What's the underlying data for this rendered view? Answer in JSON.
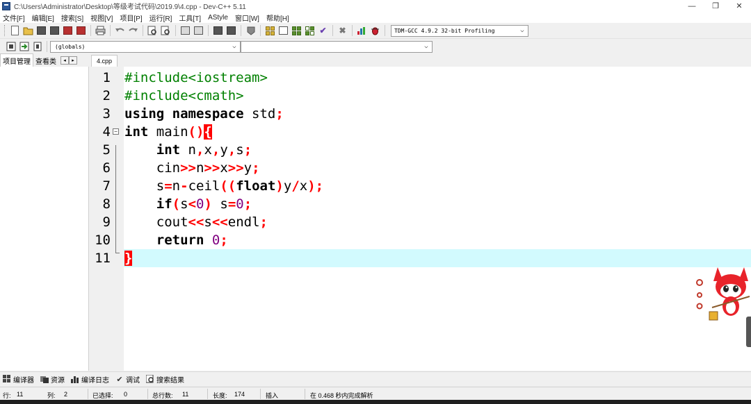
{
  "window": {
    "title": "C:\\Users\\Administrator\\Desktop\\等级考试代码\\2019.9\\4.cpp - Dev-C++ 5.11",
    "minimize": "—",
    "maximize": "❐",
    "close": "✕"
  },
  "menu": [
    "文件[F]",
    "编辑[E]",
    "搜索[S]",
    "视图[V]",
    "项目[P]",
    "运行[R]",
    "工具[T]",
    "AStyle",
    "窗口[W]",
    "帮助[H]"
  ],
  "toolbar": {
    "compiler": "TDM-GCC 4.9.2 32-bit Profiling",
    "scope": "(globals)",
    "symbol": ""
  },
  "left_panel": {
    "tabs": [
      "项目管理",
      "查看类"
    ],
    "nav_prev": "◂",
    "nav_next": "▸"
  },
  "editor": {
    "file_tab": "4.cpp",
    "line_numbers": [
      "1",
      "2",
      "3",
      "4",
      "5",
      "6",
      "7",
      "8",
      "9",
      "10",
      "11"
    ],
    "current_line": 11
  },
  "code_lines": [
    [
      {
        "t": "#include<iostream>",
        "c": "pp"
      }
    ],
    [
      {
        "t": "#include<cmath>",
        "c": "pp"
      }
    ],
    [
      {
        "t": "using namespace",
        "c": "kw"
      },
      {
        "t": " std",
        "c": ""
      },
      {
        "t": ";",
        "c": "sym"
      }
    ],
    [
      {
        "t": "int",
        "c": "kw"
      },
      {
        "t": " main",
        "c": ""
      },
      {
        "t": "()",
        "c": "sym"
      },
      {
        "t": "{",
        "c": "hl"
      }
    ],
    [
      {
        "t": "    ",
        "c": ""
      },
      {
        "t": "int",
        "c": "kw"
      },
      {
        "t": " n",
        "c": ""
      },
      {
        "t": ",",
        "c": "sym"
      },
      {
        "t": "x",
        "c": ""
      },
      {
        "t": ",",
        "c": "sym"
      },
      {
        "t": "y",
        "c": ""
      },
      {
        "t": ",",
        "c": "sym"
      },
      {
        "t": "s",
        "c": ""
      },
      {
        "t": ";",
        "c": "sym"
      }
    ],
    [
      {
        "t": "    cin",
        "c": ""
      },
      {
        "t": ">>",
        "c": "sym"
      },
      {
        "t": "n",
        "c": ""
      },
      {
        "t": ">>",
        "c": "sym"
      },
      {
        "t": "x",
        "c": ""
      },
      {
        "t": ">>",
        "c": "sym"
      },
      {
        "t": "y",
        "c": ""
      },
      {
        "t": ";",
        "c": "sym"
      }
    ],
    [
      {
        "t": "    s",
        "c": ""
      },
      {
        "t": "=",
        "c": "sym"
      },
      {
        "t": "n",
        "c": ""
      },
      {
        "t": "-",
        "c": "sym"
      },
      {
        "t": "ceil",
        "c": ""
      },
      {
        "t": "((",
        "c": "sym"
      },
      {
        "t": "float",
        "c": "kw"
      },
      {
        "t": ")",
        "c": "sym"
      },
      {
        "t": "y",
        "c": ""
      },
      {
        "t": "/",
        "c": "sym"
      },
      {
        "t": "x",
        "c": ""
      },
      {
        "t": ");",
        "c": "sym"
      }
    ],
    [
      {
        "t": "    ",
        "c": ""
      },
      {
        "t": "if",
        "c": "kw"
      },
      {
        "t": "(",
        "c": "sym"
      },
      {
        "t": "s",
        "c": ""
      },
      {
        "t": "<",
        "c": "sym"
      },
      {
        "t": "0",
        "c": "num"
      },
      {
        "t": ")",
        "c": "sym"
      },
      {
        "t": " s",
        "c": ""
      },
      {
        "t": "=",
        "c": "sym"
      },
      {
        "t": "0",
        "c": "num"
      },
      {
        "t": ";",
        "c": "sym"
      }
    ],
    [
      {
        "t": "    cout",
        "c": ""
      },
      {
        "t": "<<",
        "c": "sym"
      },
      {
        "t": "s",
        "c": ""
      },
      {
        "t": "<<",
        "c": "sym"
      },
      {
        "t": "endl",
        "c": ""
      },
      {
        "t": ";",
        "c": "sym"
      }
    ],
    [
      {
        "t": "    ",
        "c": ""
      },
      {
        "t": "return",
        "c": "kw"
      },
      {
        "t": " ",
        "c": ""
      },
      {
        "t": "0",
        "c": "num"
      },
      {
        "t": ";",
        "c": "sym"
      }
    ],
    [
      {
        "t": "}",
        "c": "hl"
      }
    ]
  ],
  "bottom_tabs": [
    {
      "icon": "compiler-grid-icon",
      "label": "编译器"
    },
    {
      "icon": "resources-icon",
      "label": "资源"
    },
    {
      "icon": "bar-chart-icon",
      "label": "编译日志"
    },
    {
      "icon": "checkmark-icon",
      "label": "调试"
    },
    {
      "icon": "search-results-icon",
      "label": "搜索结果"
    }
  ],
  "status": {
    "row_label": "行:",
    "row": "11",
    "col_label": "列:",
    "col": "2",
    "selected_label": "已选择:",
    "selected": "0",
    "total_label": "总行数:",
    "total": "11",
    "length_label": "长度:",
    "length": "174",
    "mode": "插入",
    "message": "在 0.468 秒内完成解析"
  },
  "colors": {
    "current_line_bg": "#d2fafe",
    "preprocessor": "#008000",
    "number": "#800080",
    "symbol": "#ff0000",
    "brace_highlight_bg": "#ff0000"
  }
}
